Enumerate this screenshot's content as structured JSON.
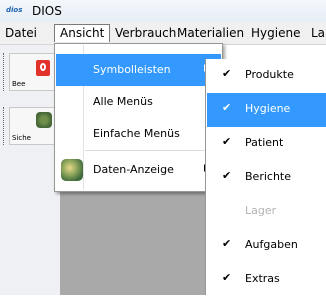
{
  "window": {
    "app_icon_text": "dios",
    "title": "DIOS"
  },
  "menubar": {
    "items": [
      {
        "label": "Datei"
      },
      {
        "label": "Ansicht"
      },
      {
        "label": "Verbrauch"
      },
      {
        "label": "Materialien"
      },
      {
        "label": "Hygiene"
      },
      {
        "label": "La"
      }
    ]
  },
  "toolbar": {
    "buttons": [
      {
        "label": "Bee"
      },
      {
        "label": "Siche"
      }
    ]
  },
  "ansicht_menu": {
    "items": [
      {
        "label": "Symbolleisten",
        "has_submenu": true,
        "highlighted": true
      },
      {
        "label": "Alle Menüs"
      },
      {
        "label": "Einfache Menüs"
      },
      {
        "label": "Daten-Anzeige",
        "has_submenu": true,
        "icon": "database-icon"
      }
    ]
  },
  "symbolleisten_submenu": {
    "items": [
      {
        "label": "Produkte",
        "checked": true,
        "check": "✔"
      },
      {
        "label": "Hygiene",
        "checked": true,
        "check": "✔",
        "highlighted": true
      },
      {
        "label": "Patient",
        "checked": true,
        "check": "✔"
      },
      {
        "label": "Berichte",
        "checked": true,
        "check": "✔"
      },
      {
        "label": "Lager",
        "checked": false,
        "check": "",
        "disabled": true
      },
      {
        "label": "Aufgaben",
        "checked": true,
        "check": "✔"
      },
      {
        "label": "Extras",
        "checked": true,
        "check": "✔"
      }
    ]
  },
  "colors": {
    "highlight": "#3399ff",
    "menubar_bg": "#f0f0f0",
    "workspace_bg": "#a9a9a9"
  }
}
